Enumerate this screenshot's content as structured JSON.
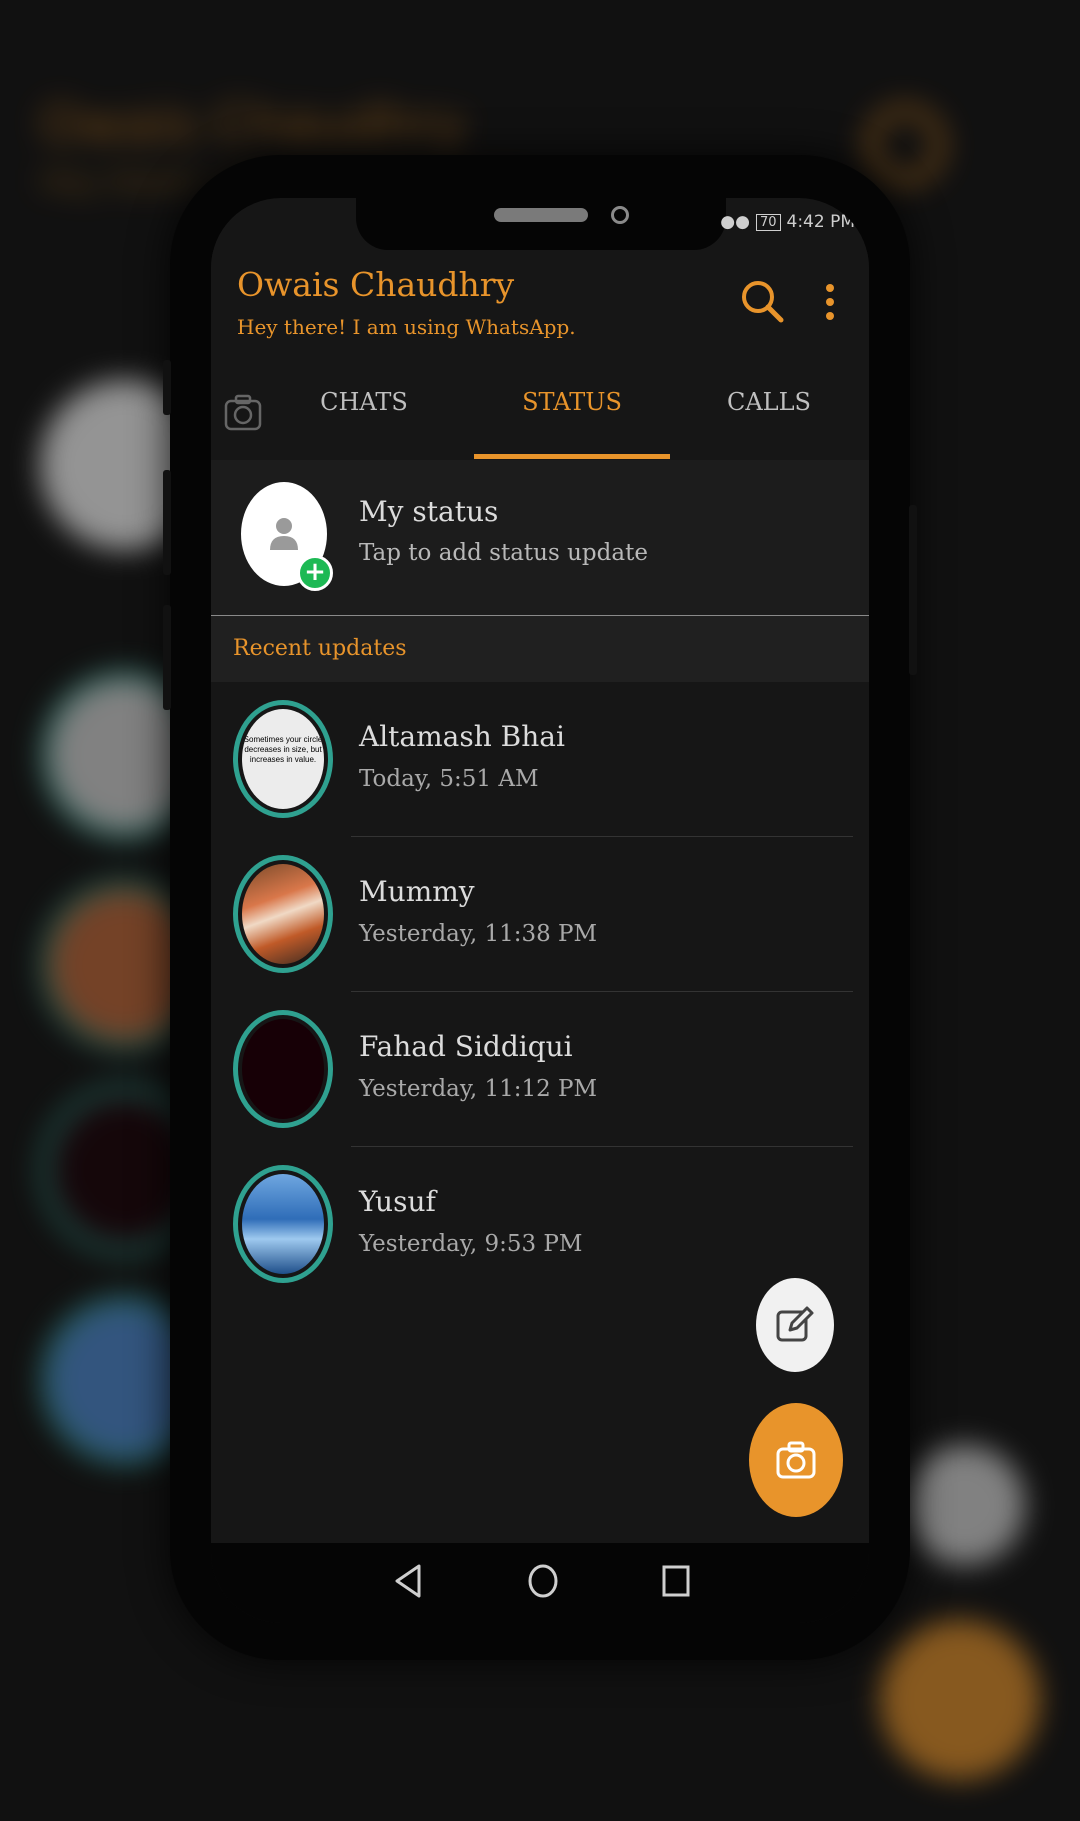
{
  "status_bar": {
    "battery": "70",
    "time": "4:42 PM"
  },
  "header": {
    "title": "Owais Chaudhry",
    "subtitle": "Hey there! I am using WhatsApp."
  },
  "tabs": [
    {
      "label": "CHATS",
      "active": false
    },
    {
      "label": "STATUS",
      "active": true
    },
    {
      "label": "CALLS",
      "active": false
    }
  ],
  "my_status": {
    "name": "My status",
    "hint": "Tap to add status update"
  },
  "recent": {
    "header": "Recent updates",
    "items": [
      {
        "name": "Altamash Bhai",
        "time": "Today, 5:51 AM",
        "thumb_text": "Sometimes your circle decreases in size, but increases in value."
      },
      {
        "name": "Mummy",
        "time": "Yesterday, 11:38 PM"
      },
      {
        "name": "Fahad Siddiqui",
        "time": "Yesterday, 11:12 PM"
      },
      {
        "name": "Yusuf",
        "time": "Yesterday, 9:53 PM"
      }
    ]
  },
  "colors": {
    "accent": "#e8942b",
    "ring": "#2fa190",
    "background": "#161616"
  },
  "icons": [
    "search-icon",
    "more-vert-icon",
    "camera-icon",
    "pencil-icon",
    "back-icon",
    "home-icon",
    "recents-icon",
    "person-icon",
    "plus-icon"
  ]
}
